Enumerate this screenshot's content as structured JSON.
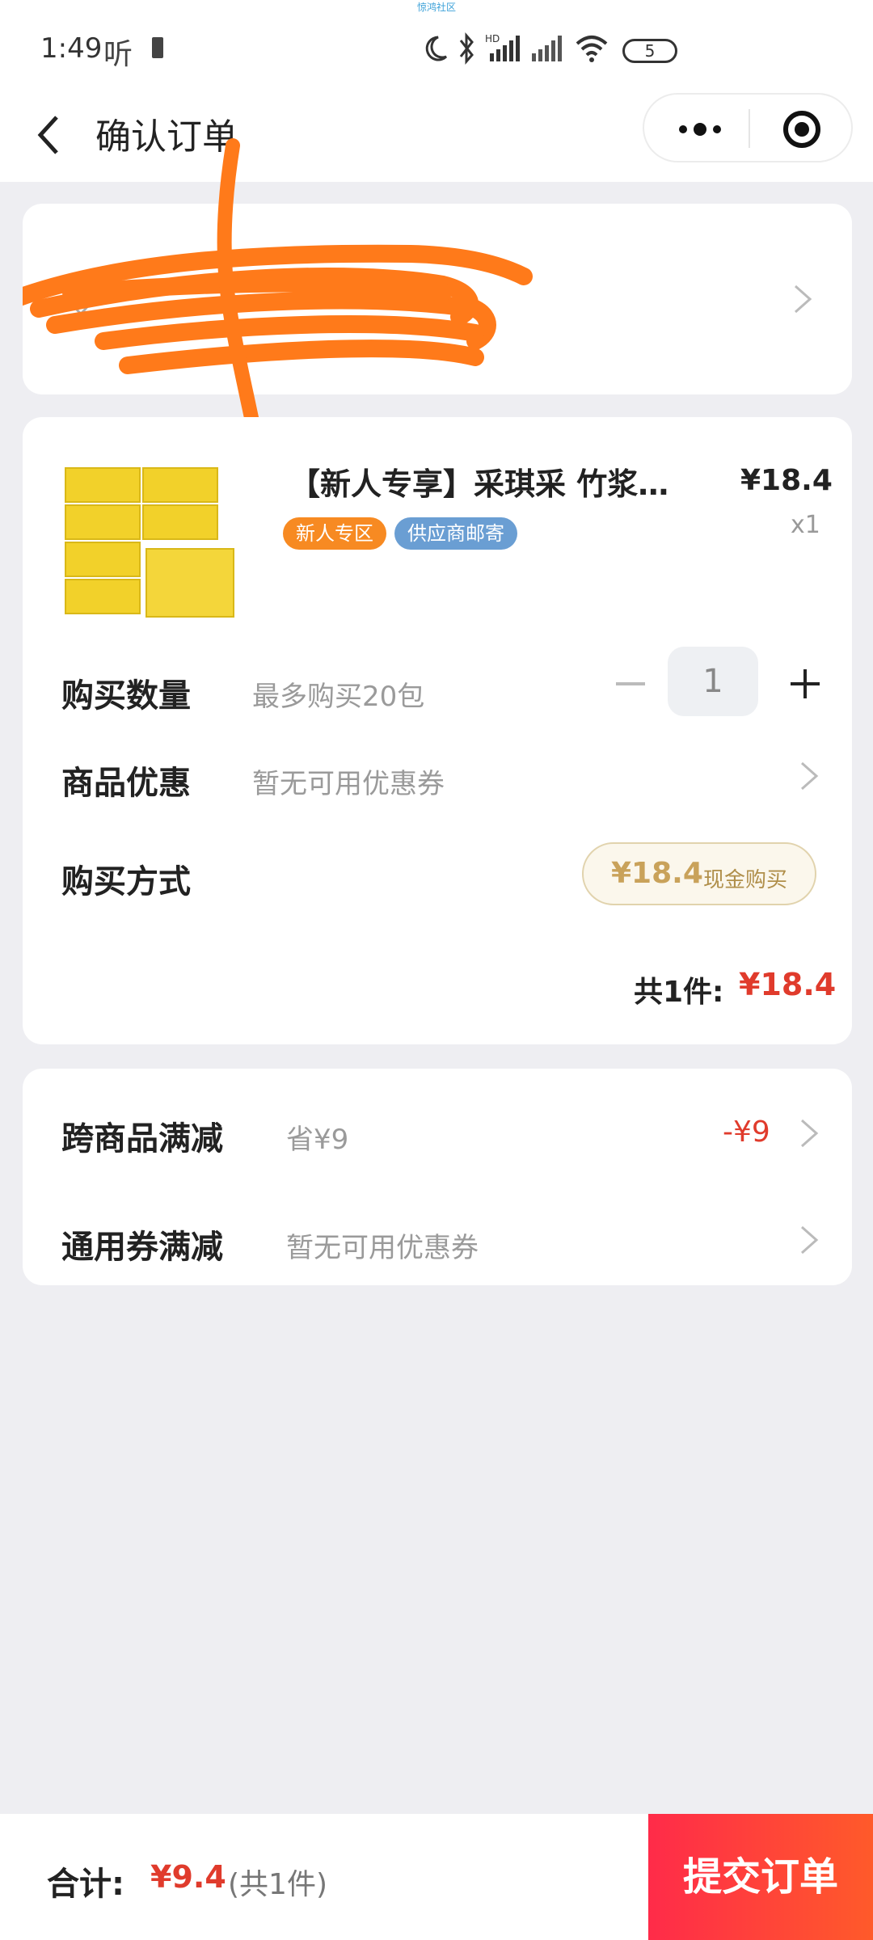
{
  "status_bar": {
    "time": "1:49",
    "net_label": "听",
    "top_text": "惊鸿社区",
    "battery": "5"
  },
  "nav": {
    "title": "确认订单"
  },
  "address": {
    "name_phone": "",
    "detail": "",
    "note": "address redacted by orange scribble"
  },
  "product": {
    "title": "【新人专享】采琪采 竹浆…",
    "price": "¥18.4",
    "qty": "x1",
    "tags": [
      {
        "label": "新人专区",
        "color": "#f78a22"
      },
      {
        "label": "供应商邮寄",
        "color": "#6a9ed3"
      }
    ]
  },
  "purchase": {
    "qty_label": "购买数量",
    "qty_hint": "最多购买20包",
    "qty_value": "1",
    "discount_label": "商品优惠",
    "discount_hint": "暂无可用优惠券",
    "method_label": "购买方式",
    "method_price": "¥18.4",
    "method_text": "现金购买",
    "summary_prefix": "共1件:",
    "summary_amount": "¥18.4"
  },
  "promotions": {
    "cross_label": "跨商品满减",
    "cross_hint": "省¥9",
    "cross_amount": "-¥9",
    "coupon_label": "通用券满减",
    "coupon_hint": "暂无可用优惠券"
  },
  "footer": {
    "total_label": "合计:",
    "total_amount": "¥9.4",
    "total_count": "(共1件)",
    "submit_label": "提交订单"
  },
  "colors": {
    "accent_red": "#e03b2c",
    "submit_gradient_start": "#ff2b49",
    "submit_gradient_end": "#ff5a2a",
    "pill_gold": "#c9a25a",
    "scribble_orange": "#ff7a1a"
  }
}
